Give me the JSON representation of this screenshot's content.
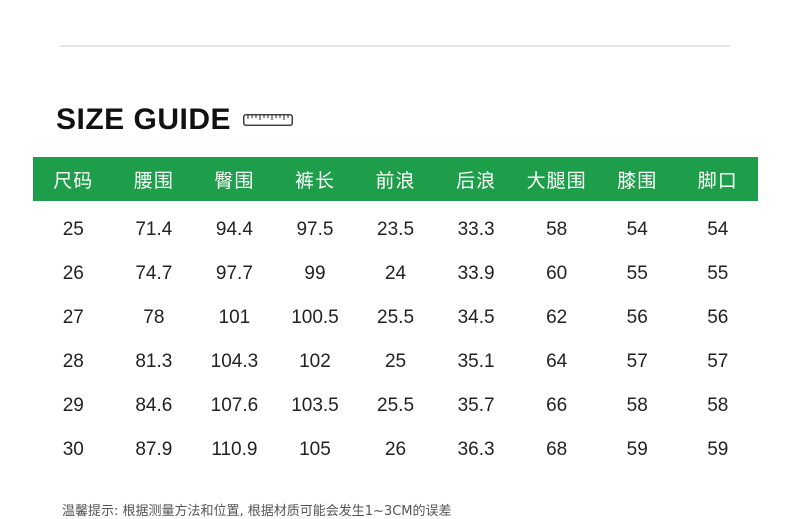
{
  "title": "SIZE GUIDE",
  "icons": {
    "ruler": "ruler-icon"
  },
  "colors": {
    "header_bg": "#1e9e4a",
    "header_text": "#ffffff"
  },
  "table": {
    "headers": [
      "尺码",
      "腰围",
      "臀围",
      "裤长",
      "前浪",
      "后浪",
      "大腿围",
      "膝围",
      "脚口"
    ],
    "rows": [
      [
        "25",
        "71.4",
        "94.4",
        "97.5",
        "23.5",
        "33.3",
        "58",
        "54",
        "54"
      ],
      [
        "26",
        "74.7",
        "97.7",
        "99",
        "24",
        "33.9",
        "60",
        "55",
        "55"
      ],
      [
        "27",
        "78",
        "101",
        "100.5",
        "25.5",
        "34.5",
        "62",
        "56",
        "56"
      ],
      [
        "28",
        "81.3",
        "104.3",
        "102",
        "25",
        "35.1",
        "64",
        "57",
        "57"
      ],
      [
        "29",
        "84.6",
        "107.6",
        "103.5",
        "25.5",
        "35.7",
        "66",
        "58",
        "58"
      ],
      [
        "30",
        "87.9",
        "110.9",
        "105",
        "26",
        "36.3",
        "68",
        "59",
        "59"
      ]
    ]
  },
  "note": "温馨提示: 根据测量方法和位置, 根据材质可能会发生1~3CM的误差"
}
